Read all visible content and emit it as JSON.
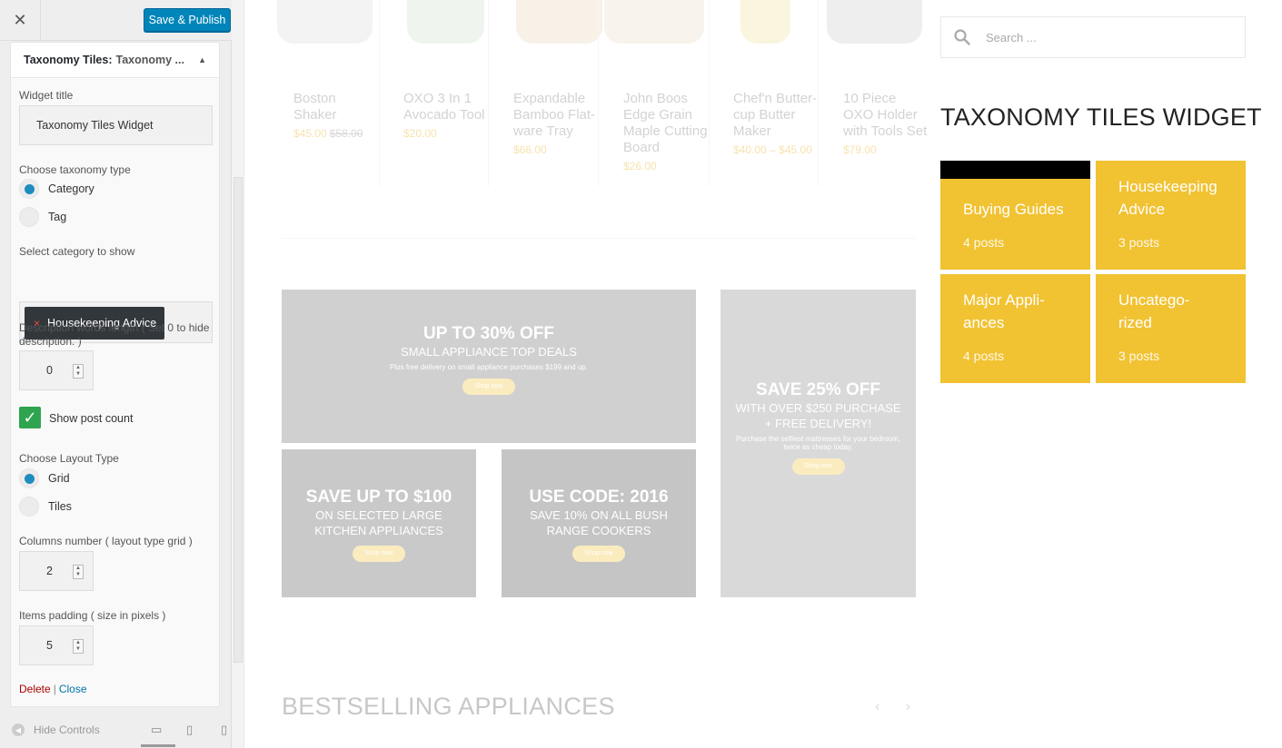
{
  "customizer": {
    "close_icon": "close-icon",
    "publish_label": "Save & Publish",
    "widget": {
      "title": "Taxonomy Tiles:",
      "subtitle": "Taxonomy ...",
      "widget_title_label": "Widget title",
      "widget_title_value": "Taxonomy Tiles Widget",
      "taxonomy_type_label": "Choose taxonomy type",
      "taxonomy_options": [
        "Category",
        "Tag"
      ],
      "taxonomy_selected": "Category",
      "category_label": "Select category to show",
      "category_chip": "Housekeeping Advice",
      "desc_length_label": "Description words length ( Set 0 to hide description. )",
      "desc_length_value": "0",
      "show_post_count_label": "Show post count",
      "show_post_count": true,
      "layout_label": "Choose Layout Type",
      "layout_options": [
        "Grid",
        "Tiles"
      ],
      "layout_selected": "Grid",
      "columns_label": "Columns number ( layout type grid )",
      "columns_value": "2",
      "padding_label": "Items padding ( size in pixels )",
      "padding_value": "5",
      "delete_label": "Delete",
      "separator": "|",
      "close_label": "Close"
    },
    "footer": {
      "hide_controls_label": "Hide Controls",
      "devices": [
        "desktop-icon",
        "tablet-icon",
        "mobile-icon"
      ]
    }
  },
  "preview": {
    "products": [
      {
        "name": "Boston Shaker",
        "price": "$45.00",
        "old_price": "$58.00"
      },
      {
        "name": "OXO 3 In 1 Avocado Tool",
        "price": "$20.00"
      },
      {
        "name": "Expandable Bamboo Flat-ware Tray",
        "price": "$66.00"
      },
      {
        "name": "John Boos Edge Grain Maple Cutting Board",
        "price": "$26.00"
      },
      {
        "name": "Chef'n Butter-cup Butter Maker",
        "price": "$40.00 – $45.00"
      },
      {
        "name": "10 Piece OXO Holder with Tools Set",
        "price": "$79.00"
      }
    ],
    "banners": [
      {
        "heading": "UP TO 30% OFF",
        "sub": "SMALL APPLIANCE TOP DEALS",
        "text": "Plus free delivery on small appliance purchases $199 and up.",
        "button": "Shop now"
      },
      {
        "heading": "SAVE 25% OFF",
        "sub": "WITH OVER $250 PURCHASE + FREE DELIVERY!",
        "text": "Purchase the selfiest mattresses for your bedroom, twice as cheap today.",
        "button": "Shop now"
      },
      {
        "heading": "SAVE UP TO $100",
        "sub": "ON SELECTED LARGE KITCHEN APPLIANCES",
        "button": "Shop now"
      },
      {
        "heading": "USE CODE: 2016",
        "sub": "SAVE 10% ON ALL BUSH RANGE COOKERS",
        "button": "Shop now"
      }
    ],
    "bestselling_title": "BESTSELLING APPLIANCES",
    "prev_arrow": "‹",
    "next_arrow": "›"
  },
  "sidebar": {
    "search_placeholder": "Search ...",
    "widget_title": "TAXONOMY TILES WIDGET",
    "tile_color": "#f1c232",
    "tiles": [
      {
        "name": "Buying Guides",
        "count": "4 posts"
      },
      {
        "name": "Housekeeping Advice",
        "count": "3 posts"
      },
      {
        "name": "Major Appli-ances",
        "count": "4 posts"
      },
      {
        "name": "Uncatego-rized",
        "count": "3 posts"
      }
    ]
  }
}
